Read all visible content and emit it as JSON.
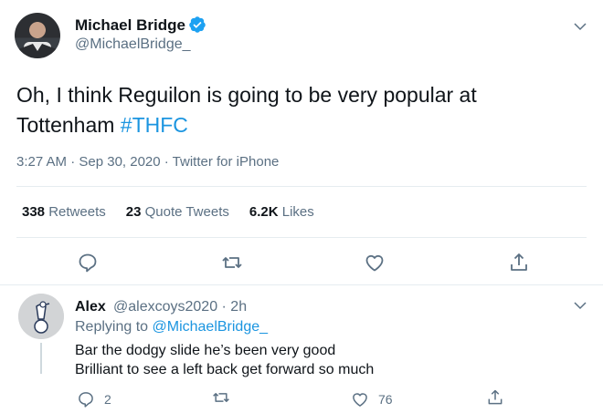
{
  "tweet": {
    "author_name": "Michael Bridge",
    "author_handle": "@MichaelBridge_",
    "text": "Oh, I think Reguilon is going to be very popular at Tottenham ",
    "hashtag": "#THFC",
    "timestamp": "3:27 AM · Sep 30, 2020 · Twitter for iPhone",
    "stats": {
      "retweets_count": "338",
      "retweets_label": "Retweets",
      "quote_count": "23",
      "quote_label": "Quote Tweets",
      "likes_count": "6.2K",
      "likes_label": "Likes"
    },
    "actions": [
      "reply-icon",
      "retweet-icon",
      "like-icon",
      "share-icon"
    ]
  },
  "reply": {
    "author_name": "Alex",
    "author_handle": "@alexcoys2020 · 2h",
    "replying_prefix": "Replying to ",
    "replying_to": "@MichaelBridge_",
    "line1": "Bar the dodgy slide he’s been very good",
    "line2": "Brilliant to see a left back get forward so much",
    "reply_count": "2",
    "like_count": "76"
  },
  "colors": {
    "accent": "#1b95e0",
    "secondary_text": "#5b7083",
    "divider": "#e6ecf0"
  }
}
